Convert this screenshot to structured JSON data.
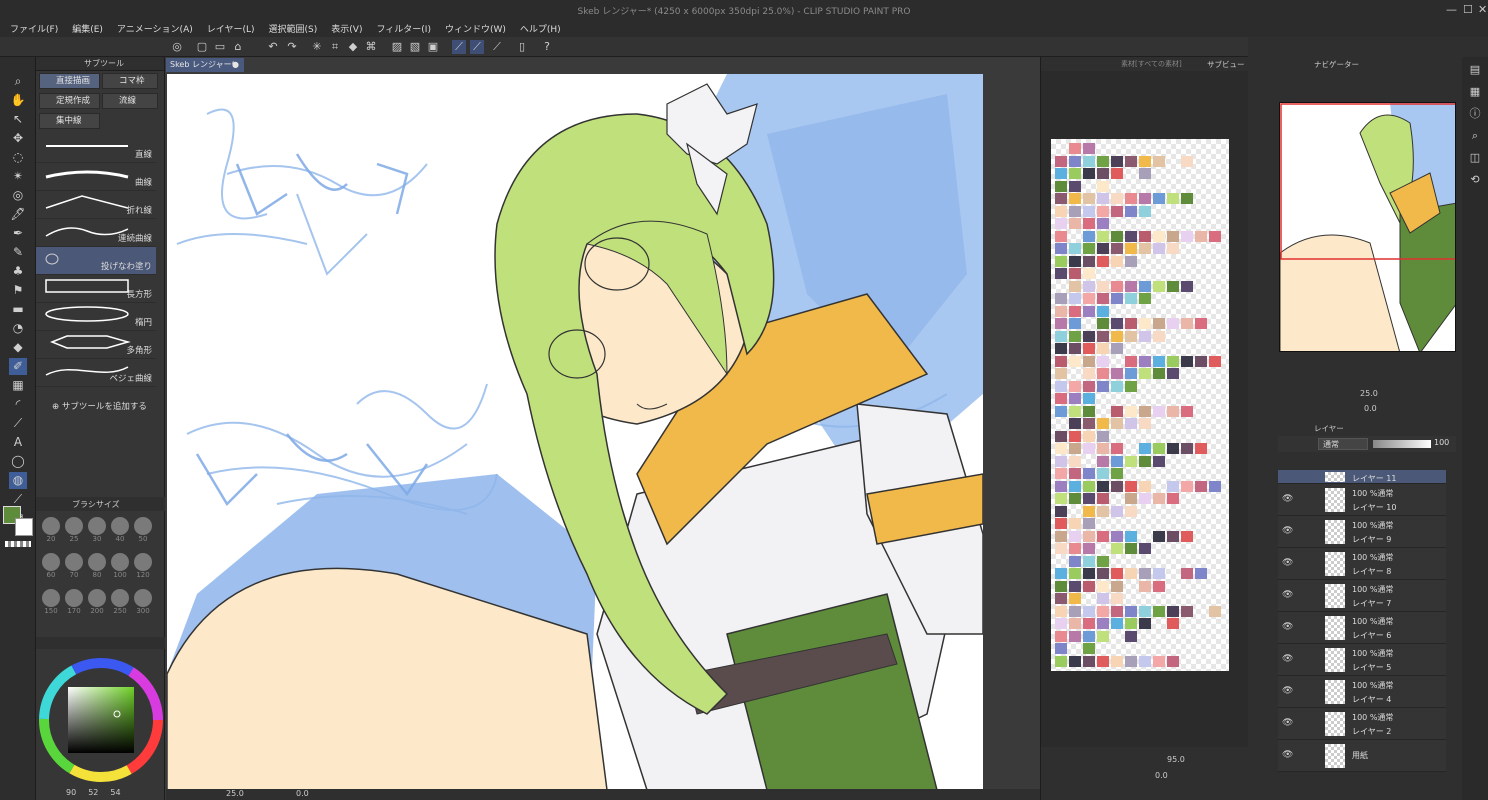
{
  "window": {
    "title": "Skeb レンジャー* (4250 x 6000px 350dpi 25.0%) - CLIP STUDIO PAINT PRO",
    "minimize": "—",
    "maximize": "☐",
    "close": "✕"
  },
  "menu": [
    "ファイル(F)",
    "編集(E)",
    "アニメーション(A)",
    "レイヤー(L)",
    "選択範囲(S)",
    "表示(V)",
    "フィルター(I)",
    "ウィンドウ(W)",
    "ヘルプ(H)"
  ],
  "subtool_panel": {
    "tab": "サブツール",
    "categories": [
      "直接描画",
      "コマ枠",
      "定規作成",
      "流線",
      "集中線"
    ],
    "selected_category": "直接描画",
    "items": [
      "直線",
      "曲線",
      "折れ線",
      "連続曲線",
      "投げなわ塗り",
      "長方形",
      "楕円",
      "多角形",
      "ベジェ曲線"
    ],
    "selected_item": "投げなわ塗り",
    "add_subtool": "サブツールを追加する"
  },
  "brush_size": {
    "tab": "ブラシサイズ",
    "sizes": [
      "20",
      "25",
      "30",
      "40",
      "50",
      "60",
      "70",
      "80",
      "100",
      "120",
      "150",
      "170",
      "200",
      "250",
      "300"
    ]
  },
  "color_status": {
    "h": "90",
    "s": "52",
    "v": "54"
  },
  "document_tab": "Skeb レンジャー*",
  "canvas_status": {
    "zoom": "25.0",
    "angle": "0.0"
  },
  "material_panel": {
    "tab1": "素材[すべての素材]",
    "tab2": "サブビュー"
  },
  "palette_footer": {
    "zoom": "95.0",
    "angle": "0.0"
  },
  "navigator": {
    "tab": "ナビゲーター",
    "zoom": "25.0",
    "angle": "0.0"
  },
  "layer_panel": {
    "tab": "レイヤー",
    "blend_mode": "通常",
    "opacity": "100",
    "layers": [
      {
        "mode": "",
        "name": "レイヤー 11"
      },
      {
        "mode": "100 %通常",
        "name": "レイヤー 10"
      },
      {
        "mode": "100 %通常",
        "name": "レイヤー 9"
      },
      {
        "mode": "100 %通常",
        "name": "レイヤー 8"
      },
      {
        "mode": "100 %通常",
        "name": "レイヤー 7"
      },
      {
        "mode": "100 %通常",
        "name": "レイヤー 6"
      },
      {
        "mode": "100 %通常",
        "name": "レイヤー 5"
      },
      {
        "mode": "100 %通常",
        "name": "レイヤー 4"
      },
      {
        "mode": "100 %通常",
        "name": "レイヤー 2"
      },
      {
        "mode": "",
        "name": "用紙"
      }
    ]
  },
  "colors": {
    "accent": "#3f5d97",
    "hair": "#bfe07a",
    "skin": "#fde9c9",
    "scarf": "#f1b84a",
    "sketch": "#a8c6f0",
    "main_color": "#5f8c3a"
  }
}
